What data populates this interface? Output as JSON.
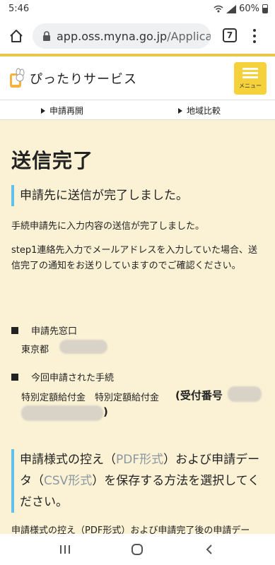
{
  "status_bar": {
    "time": "5:46",
    "battery": "60%"
  },
  "browser": {
    "url_host": "app.oss.myna.go.jp",
    "url_path": "/Applica",
    "tab_count": "7"
  },
  "header": {
    "site_name": "ぴったりサービス",
    "menu_label": "メニュー"
  },
  "sub_nav": {
    "resume": "申請再開",
    "compare": "地域比較"
  },
  "main": {
    "title": "送信完了",
    "status_heading": "申請先に送信が完了しました。",
    "para1": "手続申請先に入力内容の送信が完了しました。",
    "para2": "step1連絡先入力でメールアドレスを入力していた場合、送信完了の通知をお送りしていますのでご確認ください。",
    "recipient_label": "申請先窓口",
    "recipient_value": "東京都",
    "procedure_label": "今回申請された手続",
    "procedure_value": "特別定額給付金　特別定額給付金",
    "receipt_open": "(受付番号",
    "receipt_close": ")",
    "save_heading_1": "申請様式の控え（",
    "save_heading_pdf": "PDF形式",
    "save_heading_2": "）および申請データ（",
    "save_heading_csv": "CSV形式",
    "save_heading_3": "）を保存する方法を選択してください。",
    "bottom_text": "申請様式の控え（PDF形式）および申請完了後の申請デー"
  },
  "colors": {
    "accent_gold": "#e8c84a",
    "menu_yellow": "#f5d23c",
    "heading_bar": "#62c0ef",
    "page_bg": "#fbf2d5"
  }
}
